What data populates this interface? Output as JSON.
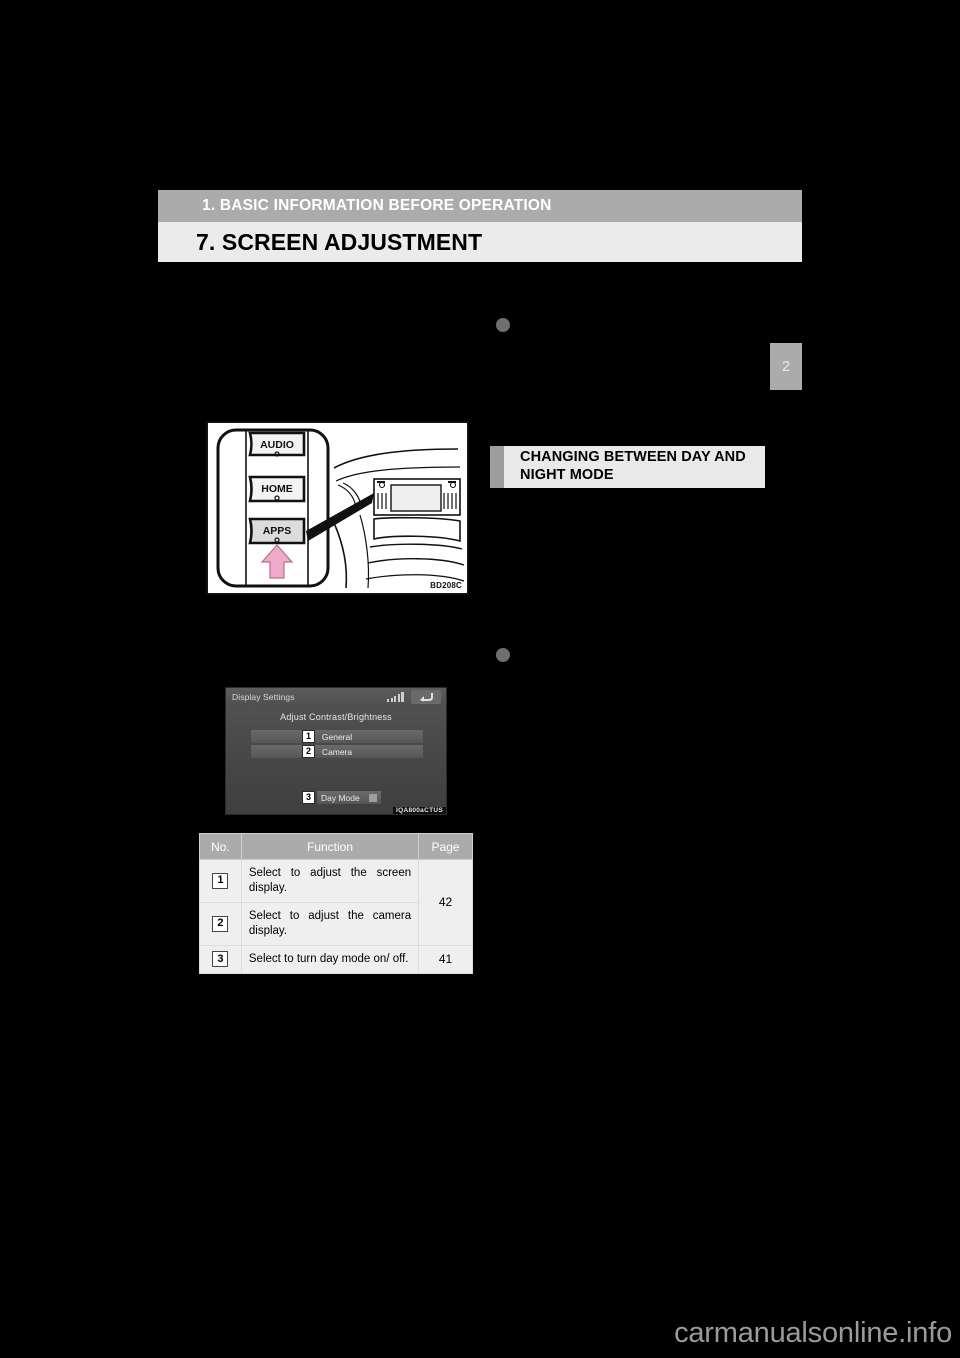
{
  "header": {
    "chapter": "1. BASIC INFORMATION BEFORE OPERATION",
    "section": "7. SCREEN ADJUSTMENT"
  },
  "page_tab": {
    "number": "2"
  },
  "subheading": {
    "title": "CHANGING BETWEEN DAY AND NIGHT MODE"
  },
  "figure_dashboard": {
    "buttons": [
      "AUDIO",
      "HOME",
      "APPS"
    ],
    "credit": "BD208C"
  },
  "figure_screen": {
    "title": "Display Settings",
    "heading": "Adjust Contrast/Brightness",
    "rows": [
      {
        "num": "1",
        "label": "General"
      },
      {
        "num": "2",
        "label": "Camera"
      }
    ],
    "day_mode": {
      "num": "3",
      "label": "Day Mode"
    },
    "back_icon": "back-arrow-icon",
    "credit": "IQA800aCTUS"
  },
  "table": {
    "headers": [
      "No.",
      "Function",
      "Page"
    ],
    "rows": [
      {
        "no": "1",
        "function": "Select to adjust the screen display.",
        "page": "42",
        "page_rowspan": 2
      },
      {
        "no": "2",
        "function": "Select to adjust the camera display.",
        "page": "",
        "page_rowspan": 0
      },
      {
        "no": "3",
        "function": "Select to turn day mode on/ off.",
        "page": "41",
        "page_rowspan": 1
      }
    ]
  },
  "watermark": {
    "text": "carmanualsonline.info"
  },
  "colors": {
    "chapter_bar": "#ababab",
    "section_bar": "#ebebeb",
    "subhead_bg": "#e9e9e9",
    "subhead_accent": "#9e9e9e",
    "table_header": "#ababab",
    "table_body": "#efefef",
    "bullet": "#6f6f6f",
    "page_bg": "#000000",
    "arrow_highlight": "#e8a8c6"
  }
}
